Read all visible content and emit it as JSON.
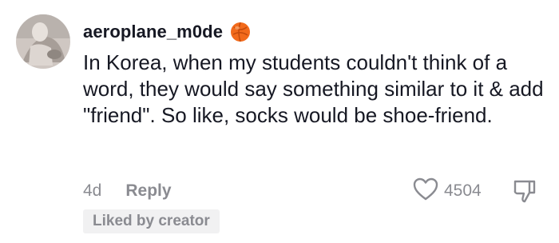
{
  "comment": {
    "username": "aeroplane_m0de",
    "badge_icon": "orange-ball-emoji-icon",
    "text": "In Korea, when my students couldn't think of a word, they would say something similar to it & add \"friend\". So like, socks would be shoe-friend.",
    "age": "4d",
    "reply_label": "Reply",
    "like_count": "4504",
    "liked_by_creator_label": "Liked by creator"
  },
  "icons": {
    "like": "heart-outline-icon",
    "dislike": "thumbs-down-outline-icon"
  },
  "colors": {
    "text_primary": "#161823",
    "text_secondary": "#8a8b91",
    "badge_bg": "#f1f1f2",
    "accent_orange": "#f26a1b"
  }
}
